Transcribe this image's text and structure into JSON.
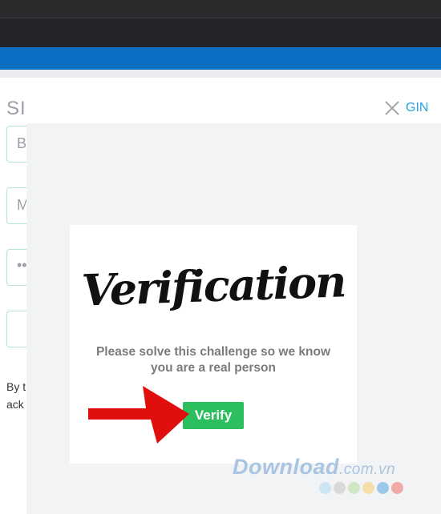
{
  "page": {
    "title": "SI",
    "login_link": "GIN",
    "fields": [
      {
        "hint": "B"
      },
      {
        "hint": "M"
      },
      {
        "hint": "••"
      },
      {
        "hint": ""
      }
    ],
    "terms_line1": "By t",
    "terms_line2": "ack"
  },
  "dialog": {
    "title": "Verification",
    "message_line1": "Please solve this challenge so we know",
    "message_line2": "you are a real person",
    "verify_label": "Verify"
  },
  "watermark": {
    "text": "Download",
    "tld": ".com.vn",
    "dot_colors": [
      "#cde4f5",
      "#d9d9d9",
      "#cfe8c2",
      "#f5dfa8",
      "#9cc9ea",
      "#f2a9a9"
    ]
  },
  "colors": {
    "brand_blue": "#0b6fc4",
    "verify_green": "#2dbe60",
    "arrow_red": "#e10e0e"
  }
}
